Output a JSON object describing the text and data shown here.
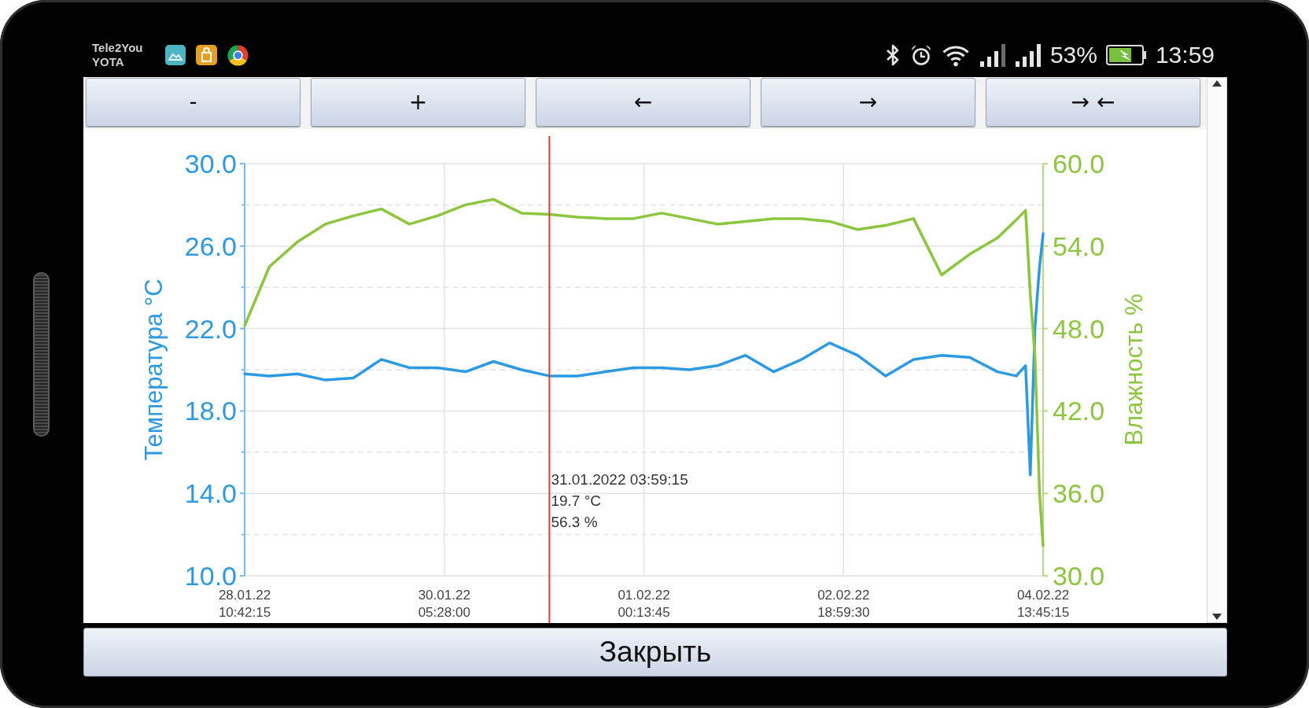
{
  "status_bar": {
    "carriers": [
      "Tele2You",
      "YOTA"
    ],
    "battery_percent": "53%",
    "time": "13:59"
  },
  "toolbar": {
    "buttons": [
      "-",
      "+",
      "←",
      "→",
      "→ ←"
    ]
  },
  "chart": {
    "chart_data": [
      {
        "type": "line",
        "ylabel": "Температура °C",
        "y2label": "Влажность %",
        "grid": true,
        "xlim": [
          "2022-01-28T10:42:15",
          "2022-02-04T13:45:15"
        ],
        "xticks": [
          {
            "value": "2022-01-28T10:42:15",
            "label": "28.01.22 10:42:15"
          },
          {
            "value": "2022-01-30T05:28:00",
            "label": "30.01.22 05:28:00"
          },
          {
            "value": "2022-02-01T00:13:45",
            "label": "01.02.22 00:13:45"
          },
          {
            "value": "2022-02-02T18:59:30",
            "label": "02.02.22 18:59:30"
          },
          {
            "value": "2022-02-04T13:45:15",
            "label": "04.02.22 13:45:15"
          }
        ],
        "ylim": [
          10,
          30
        ],
        "yticks": [
          {
            "value": 10,
            "label": "10.0"
          },
          {
            "value": 14,
            "label": "14.0"
          },
          {
            "value": 18,
            "label": "18.0"
          },
          {
            "value": 22,
            "label": "22.0"
          },
          {
            "value": 26,
            "label": "26.0"
          },
          {
            "value": 30,
            "label": "30.0"
          }
        ],
        "y2lim": [
          30,
          60
        ],
        "y2ticks": [
          {
            "value": 30,
            "label": "30.0"
          },
          {
            "value": 36,
            "label": "36.0"
          },
          {
            "value": 42,
            "label": "42.0"
          },
          {
            "value": 48,
            "label": "48.0"
          },
          {
            "value": 54,
            "label": "54.0"
          },
          {
            "value": 60,
            "label": "60.0"
          }
        ],
        "x": [
          "2022-01-28T10:42:15",
          "2022-01-28T16:00",
          "2022-01-28T22:00",
          "2022-01-29T04:00",
          "2022-01-29T10:00",
          "2022-01-29T16:00",
          "2022-01-29T22:00",
          "2022-01-30T04:00",
          "2022-01-30T10:00",
          "2022-01-30T16:00",
          "2022-01-30T22:00",
          "2022-01-31T03:59:15",
          "2022-01-31T10:00",
          "2022-01-31T16:00",
          "2022-01-31T22:00",
          "2022-02-01T04:00",
          "2022-02-01T10:00",
          "2022-02-01T16:00",
          "2022-02-01T22:00",
          "2022-02-02T04:00",
          "2022-02-02T10:00",
          "2022-02-02T16:00",
          "2022-02-02T22:00",
          "2022-02-03T04:00",
          "2022-02-03T10:00",
          "2022-02-03T16:00",
          "2022-02-03T22:00",
          "2022-02-04T04:00",
          "2022-02-04T08:00",
          "2022-02-04T10:00",
          "2022-02-04T11:00",
          "2022-02-04T12:00",
          "2022-02-04T12:30",
          "2022-02-04T13:00",
          "2022-02-04T13:45:15"
        ],
        "series": [
          {
            "color": "#2b9ae2",
            "values": [
              19.8,
              19.7,
              19.8,
              19.5,
              19.6,
              20.5,
              20.1,
              20.1,
              19.9,
              20.4,
              20.0,
              19.7,
              19.7,
              19.9,
              20.1,
              20.1,
              20.0,
              20.2,
              20.7,
              19.9,
              20.5,
              21.3,
              20.7,
              19.7,
              20.5,
              20.7,
              20.6,
              19.9,
              19.7,
              20.2,
              14.9,
              22.0,
              23.6,
              25.0,
              26.6
            ]
          },
          {
            "color": "#8cc63e",
            "axis": "y2",
            "values": [
              48.2,
              52.5,
              54.3,
              55.6,
              56.2,
              56.7,
              55.6,
              56.2,
              57.0,
              57.4,
              56.4,
              56.3,
              56.1,
              56.0,
              56.0,
              56.4,
              56.0,
              55.6,
              55.8,
              56.0,
              56.0,
              55.8,
              55.2,
              55.5,
              56.0,
              51.9,
              53.4,
              54.6,
              55.9,
              56.6,
              50.5,
              46.0,
              41.0,
              36.0,
              32.2
            ]
          }
        ],
        "ref_lines": [
          {
            "axis": "x",
            "value": "2022-01-31T03:59:15",
            "color": "#e53935"
          }
        ],
        "annotations": [
          "31.01.2022 03:59:15",
          "19.7 °C",
          "56.3 %"
        ]
      }
    ]
  },
  "close_button": "Закрыть"
}
